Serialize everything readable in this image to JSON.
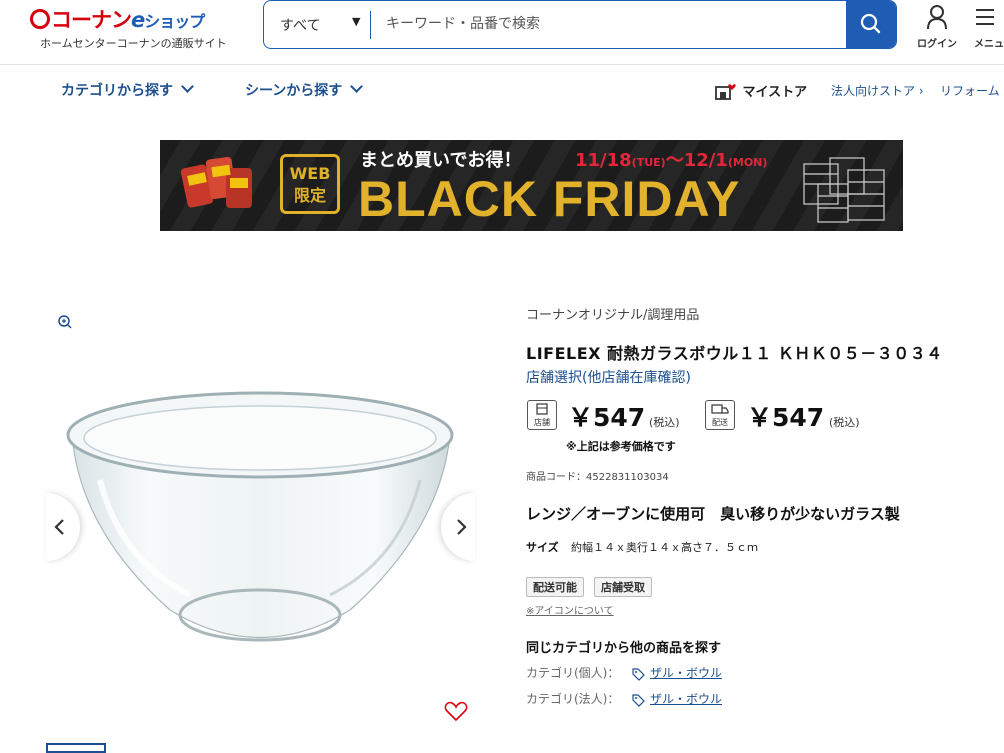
{
  "header": {
    "logo_text": "コーナン",
    "logo_e": "e",
    "logo_shop": "ショップ",
    "logo_sub": "ホームセンターコーナンの通販サイト",
    "search_category": "すべて",
    "search_placeholder": "キーワード・品番で検索",
    "login_label": "ログイン",
    "menu_label": "メニュー"
  },
  "nav": {
    "category": "カテゴリから探す",
    "scene": "シーンから探す",
    "mystore": "マイストア",
    "corporate": "法人向けストア ›",
    "reform": "リフォーム"
  },
  "banner": {
    "badge_line1": "WEB",
    "badge_line2": "限定",
    "tagline": "まとめ買いでお得！",
    "date_start": "11/18",
    "date_start_day": "(TUE)",
    "date_sep": "～",
    "date_end": "12/1",
    "date_end_day": "(MON)",
    "headline": "BLACK FRIDAY"
  },
  "product": {
    "brand": "コーナンオリジナル/調理用品",
    "title": "LIFELEX 耐熱ガラスボウル１１ ＫＨＫ０５－３０３４",
    "store_link": "店舗選択(他店舗在庫確認)",
    "store_price_label": "店舗",
    "store_price": "￥547",
    "store_tax": "(税込)",
    "delivery_price_label": "配送",
    "delivery_price": "￥547",
    "delivery_tax": "(税込)",
    "price_note": "※上記は参考価格です",
    "code": "商品コード：4522831103034",
    "catch": "レンジ／オーブンに使用可　臭い移りが少ないガラス製",
    "size_label": "サイズ",
    "size_value": "約幅１４ｘ奥行１４ｘ高さ７．５ｃｍ",
    "tags": [
      "配送可能",
      "店舗受取"
    ],
    "icon_note": "※アイコンについて",
    "same_category": "同じカテゴリから他の商品を探す",
    "categories": [
      {
        "label": "カテゴリ(個人)：",
        "link": "ザル・ボウル"
      },
      {
        "label": "カテゴリ(法人)：",
        "link": "ザル・ボウル"
      }
    ]
  },
  "colors": {
    "brand_red": "#d7000f",
    "brand_blue": "#1f5db5",
    "link_blue": "#1d4f8f",
    "banner_gold": "#e3b22c",
    "banner_red": "#e5263a"
  }
}
